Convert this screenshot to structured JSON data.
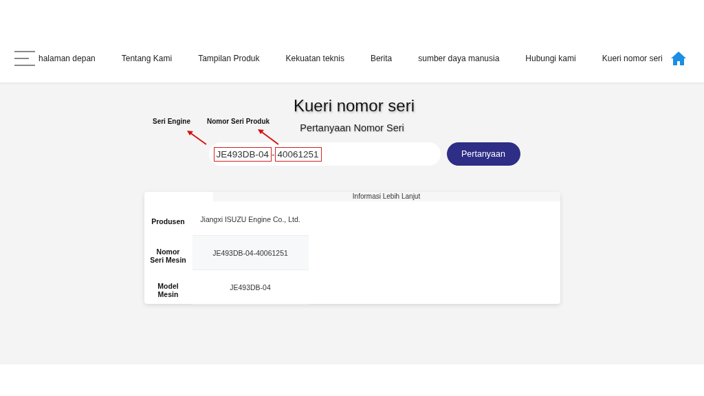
{
  "nav": {
    "items": [
      {
        "label": "halaman depan"
      },
      {
        "label": "Tentang Kami"
      },
      {
        "label": "Tampilan Produk"
      },
      {
        "label": "Kekuatan teknis"
      },
      {
        "label": "Berita"
      },
      {
        "label": "sumber daya manusia"
      },
      {
        "label": "Hubungi kami"
      },
      {
        "label": "Kueri nomor seri"
      }
    ]
  },
  "title": "Kueri nomor seri",
  "subtitle": "Pertanyaan Nomor Seri",
  "query_field": {
    "segments": [
      {
        "text": "JE493DB-04",
        "boxed": true
      },
      {
        "text": "-",
        "boxed": false
      },
      {
        "text": "40061251",
        "boxed": true
      }
    ]
  },
  "annotations": [
    {
      "label": "Seri Engine"
    },
    {
      "label": "Nomor Seri Produk"
    }
  ],
  "query_button": "Pertanyaan",
  "info_card": {
    "title": "Informasi Lebih Lanjut",
    "rows": [
      {
        "label": "Produsen",
        "value": "Jiangxi ISUZU Engine Co., Ltd."
      },
      {
        "label": "Nomor Seri Mesin",
        "value": "JE493DB-04-40061251"
      },
      {
        "label": "Model Mesin",
        "value": "JE493DB-04"
      }
    ]
  }
}
